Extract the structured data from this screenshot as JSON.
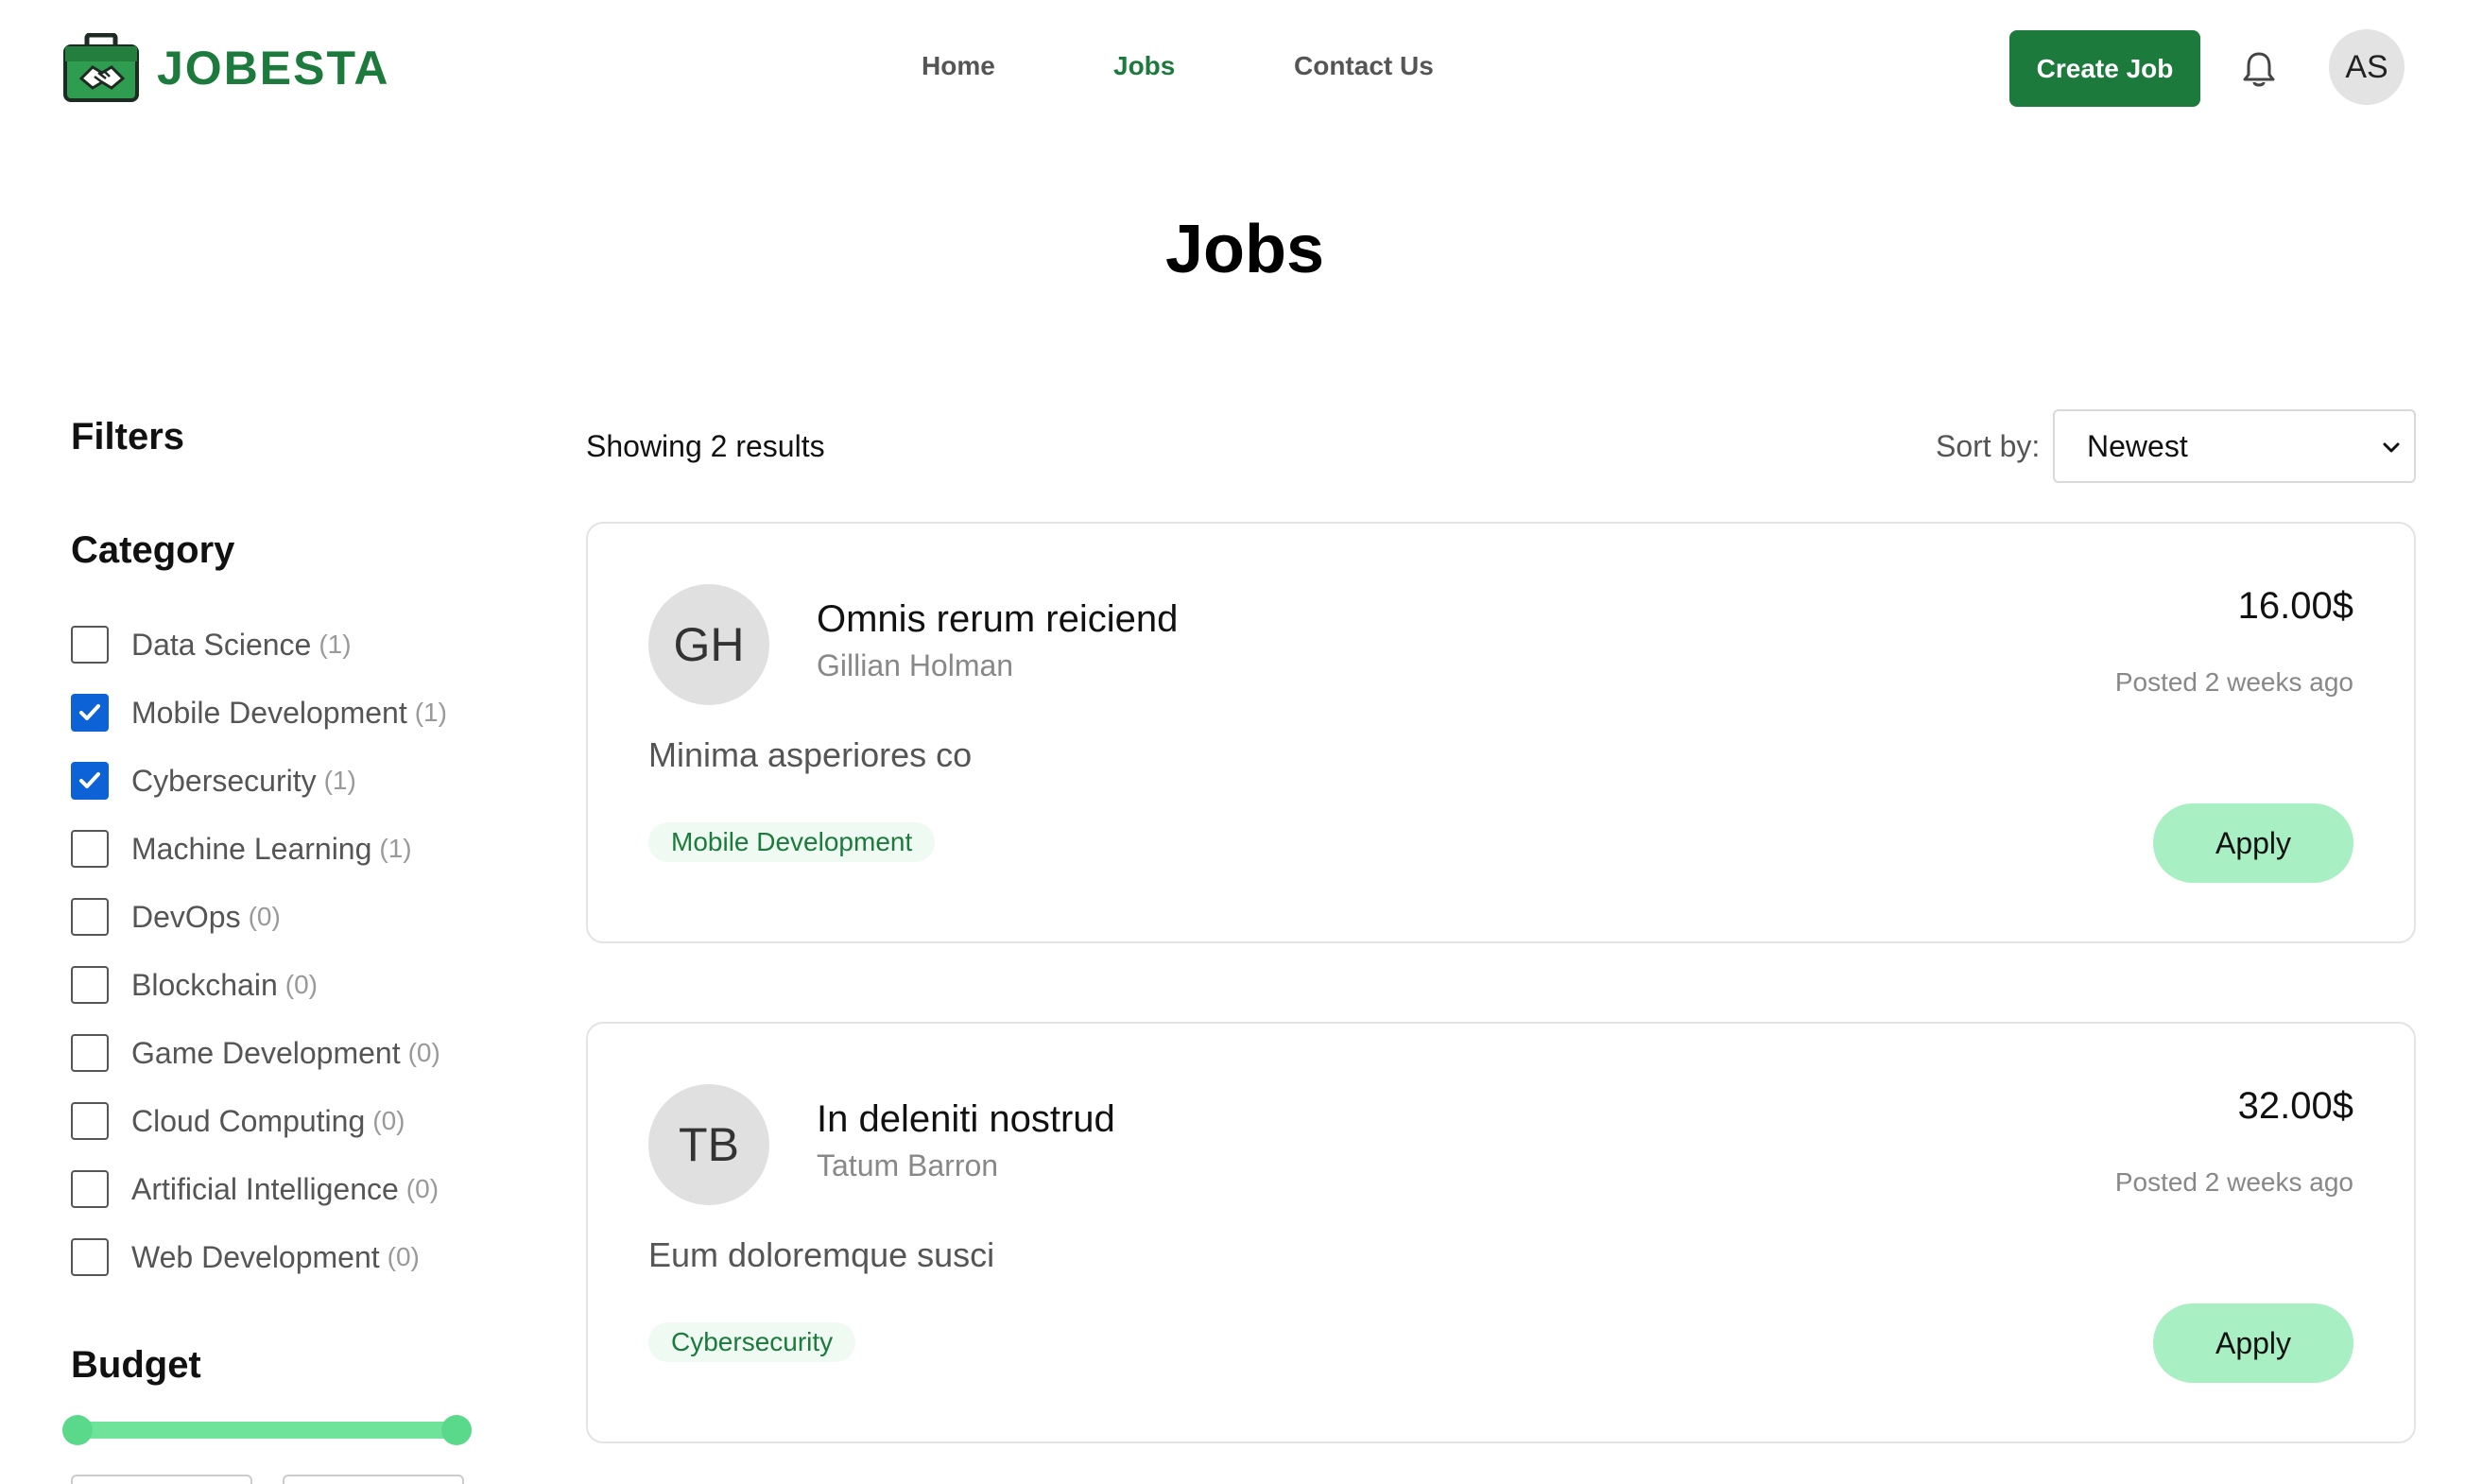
{
  "brand": {
    "name": "JOBESTA"
  },
  "nav": {
    "items": [
      "Home",
      "Jobs",
      "Contact Us"
    ],
    "active": "Jobs"
  },
  "header": {
    "create_label": "Create Job",
    "user_initials": "AS"
  },
  "page": {
    "title": "Jobs"
  },
  "filters": {
    "title": "Filters",
    "category_title": "Category",
    "categories": [
      {
        "label": "Data Science",
        "count": "(1)",
        "checked": false
      },
      {
        "label": "Mobile Development",
        "count": "(1)",
        "checked": true
      },
      {
        "label": "Cybersecurity",
        "count": "(1)",
        "checked": true
      },
      {
        "label": "Machine Learning",
        "count": "(1)",
        "checked": false
      },
      {
        "label": "DevOps",
        "count": "(0)",
        "checked": false
      },
      {
        "label": "Blockchain",
        "count": "(0)",
        "checked": false
      },
      {
        "label": "Game Development",
        "count": "(0)",
        "checked": false
      },
      {
        "label": "Cloud Computing",
        "count": "(0)",
        "checked": false
      },
      {
        "label": "Artificial Intelligence",
        "count": "(0)",
        "checked": false
      },
      {
        "label": "Web Development",
        "count": "(0)",
        "checked": false
      }
    ],
    "budget_title": "Budget"
  },
  "results": {
    "showing": "Showing 2 results",
    "sort_label": "Sort by:",
    "sort_value": "Newest"
  },
  "jobs": [
    {
      "initials": "GH",
      "title": "Omnis rerum reiciend",
      "company": "Gillian Holman",
      "description": "Minima asperiores co",
      "tag": "Mobile Development",
      "price": "16.00$",
      "posted": "Posted 2 weeks ago",
      "apply_label": "Apply"
    },
    {
      "initials": "TB",
      "title": "In deleniti nostrud",
      "company": "Tatum Barron",
      "description": "Eum doloremque susci",
      "tag": "Cybersecurity",
      "price": "32.00$",
      "posted": "Posted 2 weeks ago",
      "apply_label": "Apply"
    }
  ],
  "colors": {
    "brand": "#1b7a3c",
    "apply": "#a8efc3",
    "checkbox": "#0d63d6"
  }
}
